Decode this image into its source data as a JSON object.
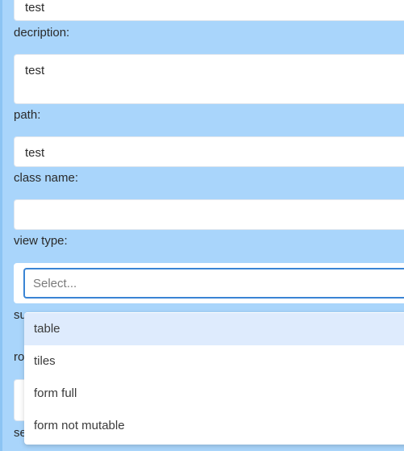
{
  "form": {
    "fields": [
      {
        "label": "",
        "value": "test"
      },
      {
        "label": "decription:",
        "value": "test"
      },
      {
        "label": "path:",
        "value": "test"
      },
      {
        "label": "class name:",
        "value": ""
      },
      {
        "label": "view type:",
        "value": ""
      }
    ],
    "partial_labels": [
      "su",
      "ro",
      "se"
    ]
  },
  "view_type_select": {
    "placeholder": "Select...",
    "options": [
      "table",
      "tiles",
      "form full",
      "form not mutable"
    ],
    "highlighted_option": "table"
  },
  "colors": {
    "background": "#a9d5fb",
    "focus_border": "#3a84d4",
    "option_highlight": "#deebfd"
  }
}
